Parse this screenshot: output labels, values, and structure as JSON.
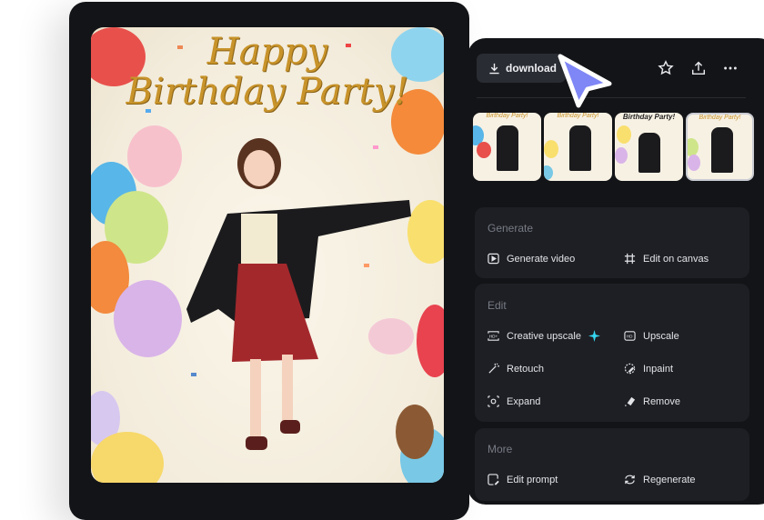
{
  "poster": {
    "title_line1": "Happy",
    "title_line2": "Birthday Party!"
  },
  "toolbar": {
    "download_label": "download",
    "icons": [
      "download-icon",
      "star-icon",
      "share-icon",
      "more-icon"
    ]
  },
  "thumbnails": [
    {
      "caption": "Birthday Party!"
    },
    {
      "caption": "Birthday Party!"
    },
    {
      "caption": "Birthday Party!"
    },
    {
      "caption": "Birthday Party!"
    }
  ],
  "sections": {
    "generate": {
      "title": "Generate",
      "items": [
        "Generate video",
        "Edit on canvas"
      ]
    },
    "edit": {
      "title": "Edit",
      "items": [
        "Creative upscale",
        "Upscale",
        "Retouch",
        "Inpaint",
        "Expand",
        "Remove"
      ]
    },
    "more": {
      "title": "More",
      "items": [
        "Edit prompt",
        "Regenerate"
      ]
    }
  },
  "colors": {
    "accent": "#7f86f5",
    "sparkle": "#35d6f0",
    "panel": "#131417",
    "card": "#1e1f24"
  }
}
